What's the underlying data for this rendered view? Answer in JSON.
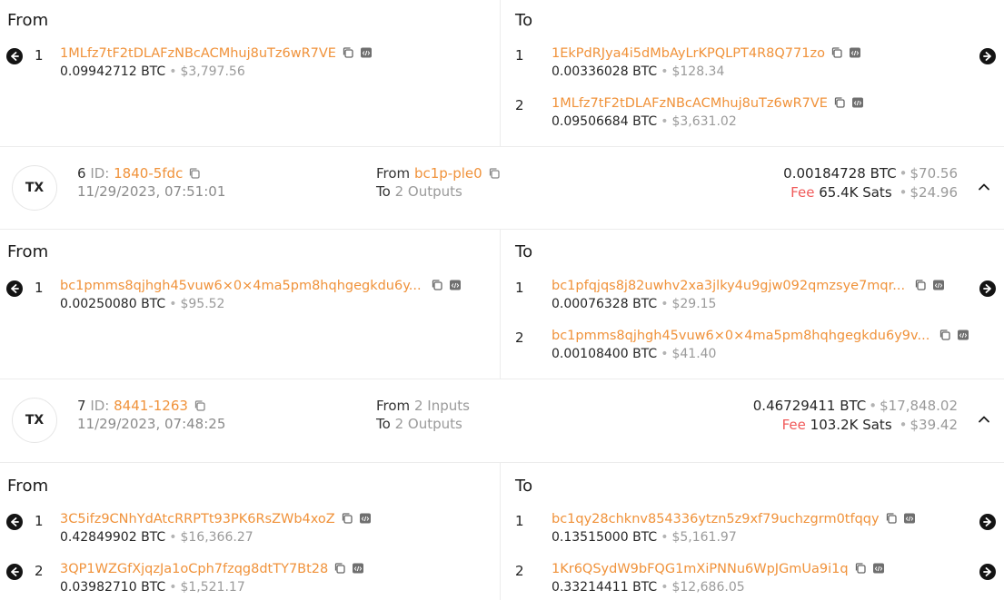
{
  "labels": {
    "from": "From",
    "to": "To",
    "tx_badge": "TX",
    "id_label": "ID:",
    "from_label": "From",
    "to_label": "To",
    "fee_label": "Fee",
    "btc_unit": "BTC",
    "dot": "•"
  },
  "block1": {
    "inputs": [
      {
        "index": "1",
        "address": "1MLfz7tF2tDLAFzNBcACMhuj8uTz6wR7VE",
        "btc": "0.09942712",
        "usd": "$3,797.56"
      }
    ],
    "outputs": [
      {
        "index": "1",
        "address": "1EkPdRJya4i5dMbAyLrKPQLPT4R8Q771zo",
        "btc": "0.00336028",
        "usd": "$128.34"
      },
      {
        "index": "2",
        "address": "1MLfz7tF2tDLAFzNBcACMhuj8uTz6wR7VE",
        "btc": "0.09506684",
        "usd": "$3,631.02"
      }
    ]
  },
  "tx6": {
    "number": "6",
    "id": "1840-5fdc",
    "time": "11/29/2023, 07:51:01",
    "from": "bc1p-ple0",
    "to": "2 Outputs",
    "btc": "0.00184728 BTC",
    "usd": "$70.56",
    "fee_sats": "65.4K Sats",
    "fee_usd": "$24.96",
    "inputs": [
      {
        "index": "1",
        "address": "bc1pmms8qjhgh45vuw6×0×4ma5pm8hqhgegkdu6y...",
        "btc": "0.00250080",
        "usd": "$95.52"
      }
    ],
    "outputs": [
      {
        "index": "1",
        "address": "bc1pfqjqs8j82uwhv2xa3jlky4u9gjw092qmzsye7mqr...",
        "btc": "0.00076328",
        "usd": "$29.15"
      },
      {
        "index": "2",
        "address": "bc1pmms8qjhgh45vuw6×0×4ma5pm8hqhgegkdu6y9v...",
        "btc": "0.00108400",
        "usd": "$41.40"
      }
    ]
  },
  "tx7": {
    "number": "7",
    "id": "8441-1263",
    "time": "11/29/2023, 07:48:25",
    "from": "2 Inputs",
    "to": "2 Outputs",
    "btc": "0.46729411 BTC",
    "usd": "$17,848.02",
    "fee_sats": "103.2K Sats",
    "fee_usd": "$39.42",
    "inputs": [
      {
        "index": "1",
        "address": "3C5ifz9CNhYdAtcRRPTt93PK6RsZWb4xoZ",
        "btc": "0.42849902",
        "usd": "$16,366.27"
      },
      {
        "index": "2",
        "address": "3QP1WZGfXjqzJa1oCph7fzqg8dtTY7Bt28",
        "btc": "0.03982710",
        "usd": "$1,521.17"
      }
    ],
    "outputs": [
      {
        "index": "1",
        "address": "bc1qy28chknv854336ytzn5z9xf79uchzgrm0tfqqy",
        "btc": "0.13515000",
        "usd": "$5,161.97"
      },
      {
        "index": "2",
        "address": "1Kr6QSydW9bFQG1mXiPNNu6WpJGmUa9i1q",
        "btc": "0.33214411",
        "usd": "$12,686.05"
      }
    ]
  },
  "icons": {
    "copy": "copy-icon",
    "code": "code-icon",
    "arrow_left": "arrow-left-icon",
    "arrow_right": "arrow-right-icon",
    "chevron_up": "chevron-up-icon"
  }
}
